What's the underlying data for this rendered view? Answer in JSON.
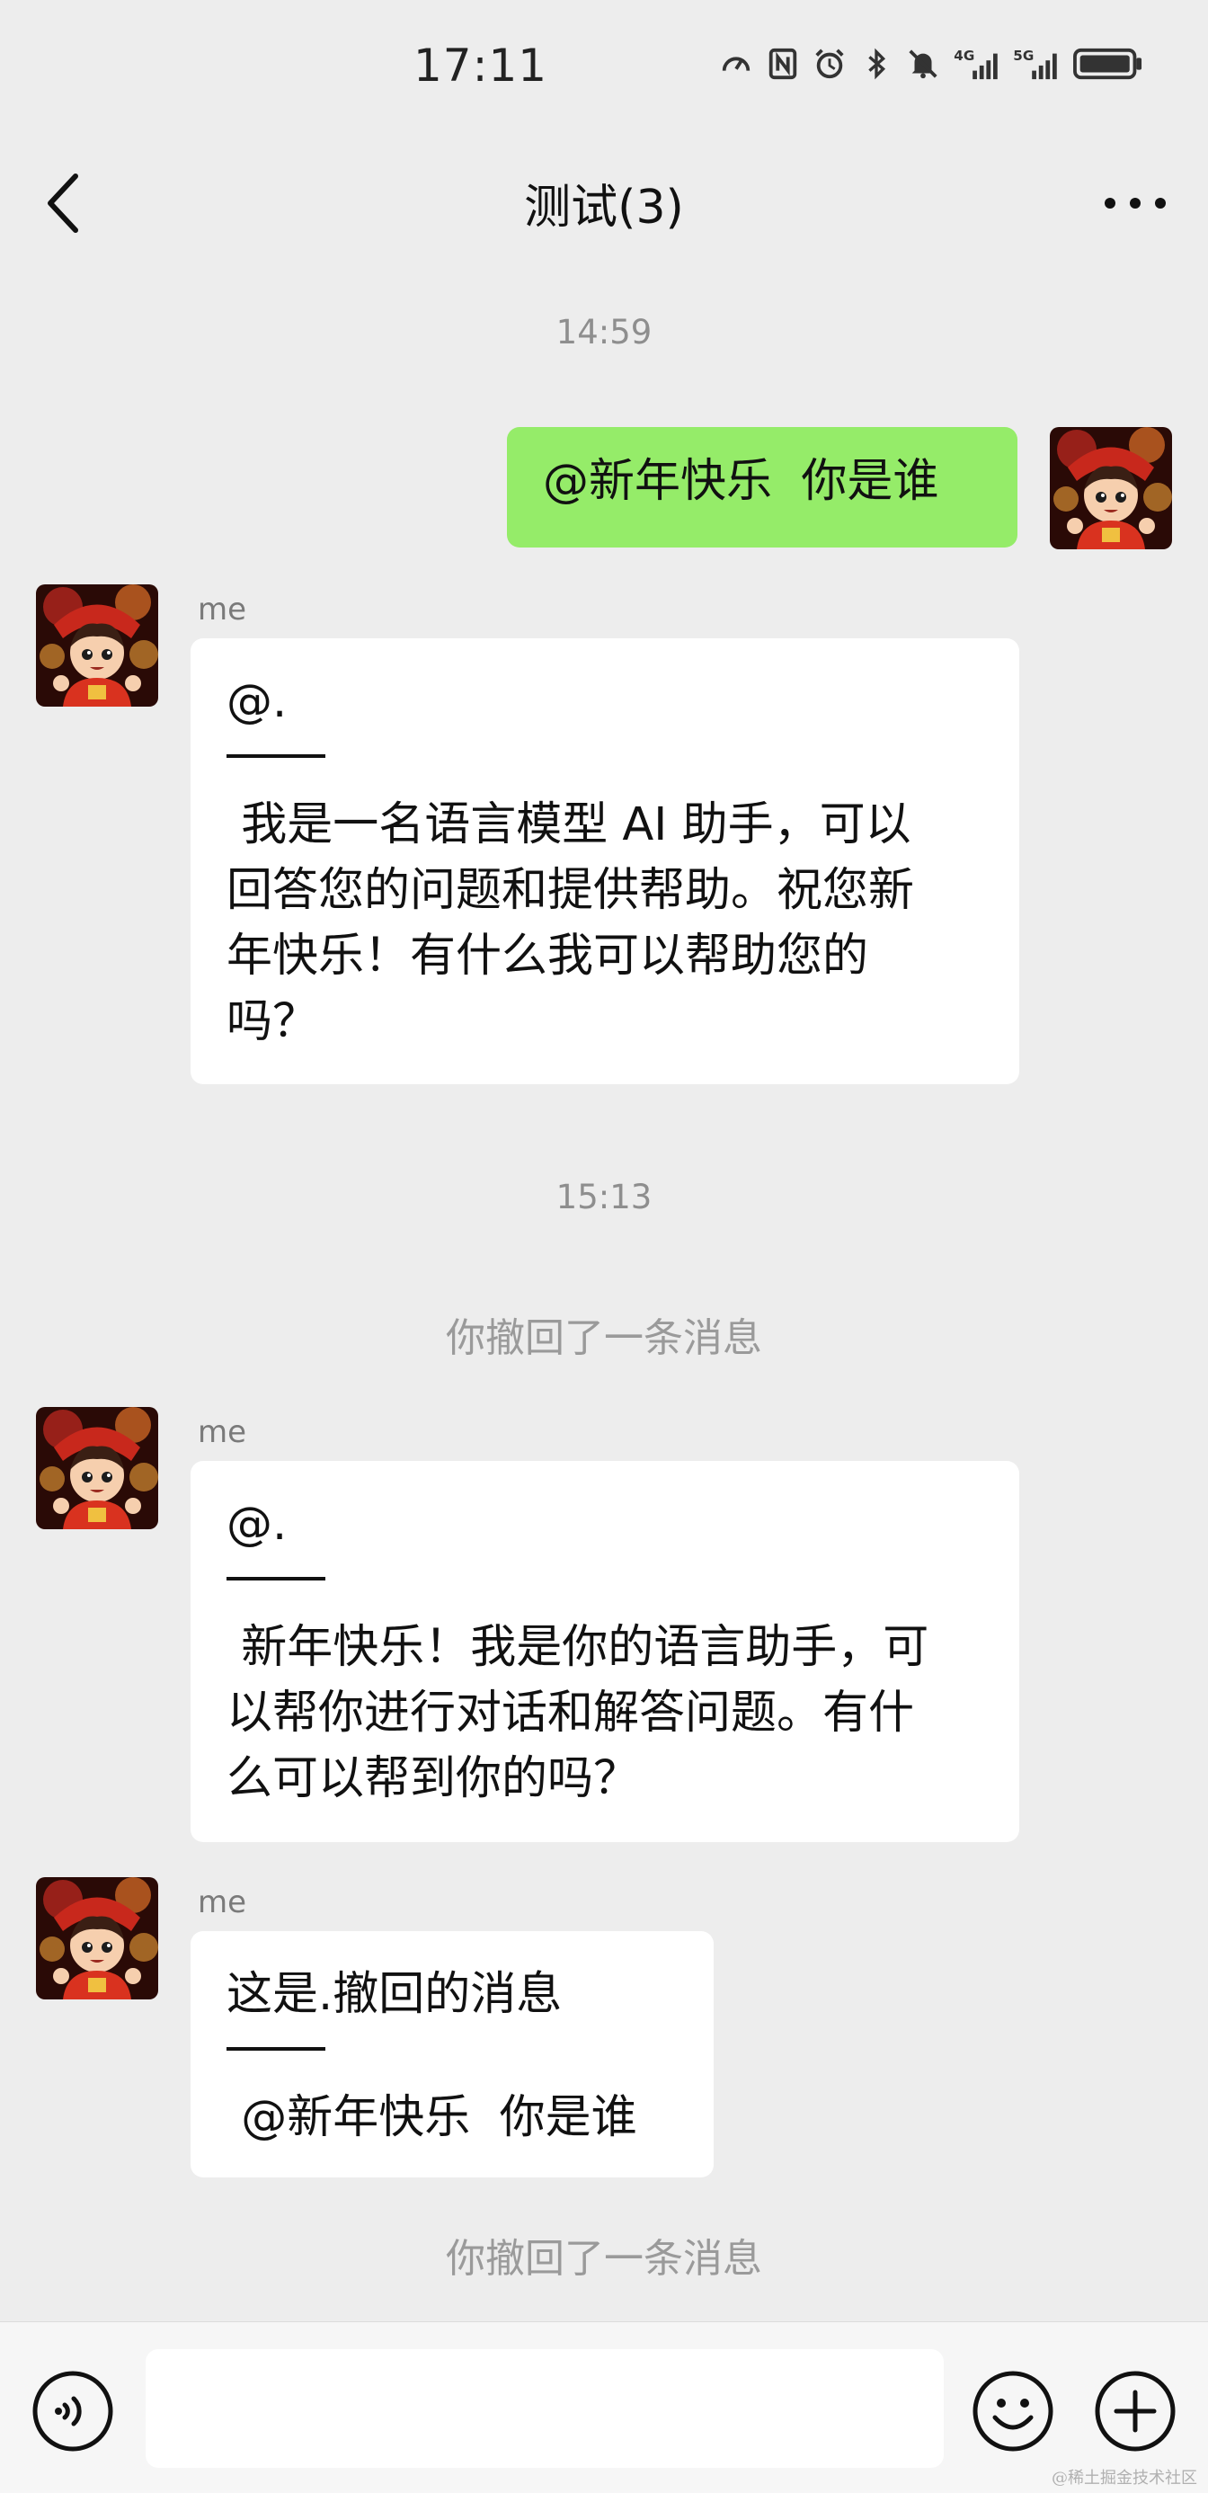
{
  "status_bar": {
    "time": "17:11",
    "icons": [
      "speed-icon",
      "nfc-icon",
      "alarm-icon",
      "bluetooth-icon",
      "mute-icon",
      "signal-4g-icon",
      "signal-5g-icon",
      "battery-icon"
    ],
    "net1": "4G",
    "net2": "5G"
  },
  "nav": {
    "title": "测试(3)",
    "back_icon": "chevron-left-icon",
    "more_icon": "more-icon"
  },
  "messages": [
    {
      "type": "time",
      "text": "14:59"
    },
    {
      "type": "sent",
      "text": "@新年快乐  你是谁"
    },
    {
      "type": "received",
      "sender": "me",
      "lines": [
        "@."
      ],
      "body": [
        " 我是一名语言模型 AI 助手，可以",
        "回答您的问题和提供帮助。祝您新",
        "年快乐！有什么我可以帮助您的",
        "吗？"
      ]
    },
    {
      "type": "time",
      "text": "15:13"
    },
    {
      "type": "recall",
      "text": "你撤回了一条消息"
    },
    {
      "type": "received",
      "sender": "me",
      "lines": [
        "@."
      ],
      "body": [
        " 新年快乐！我是你的语言助手，可",
        "以帮你进行对话和解答问题。有什",
        "么可以帮到你的吗？"
      ]
    },
    {
      "type": "received",
      "sender": "me",
      "lines": [
        "这是.撤回的消息"
      ],
      "body": [
        " @新年快乐  你是谁"
      ]
    },
    {
      "type": "recall",
      "text": "你撤回了一条消息"
    }
  ],
  "input_bar": {
    "voice_icon": "voice-icon",
    "emoji_icon": "emoji-icon",
    "plus_icon": "plus-icon",
    "text": ""
  },
  "watermark": "@稀土掘金技术社区",
  "colors": {
    "background": "#ededed",
    "sent_bubble": "#95ec69",
    "received_bubble": "#ffffff"
  }
}
